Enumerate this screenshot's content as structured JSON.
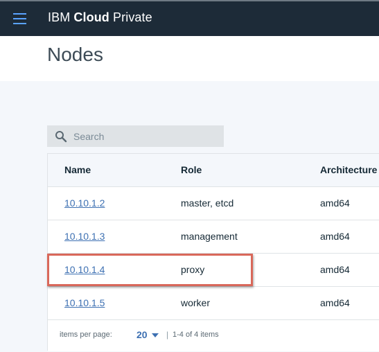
{
  "header": {
    "brand_prefix": "IBM",
    "brand_bold": "Cloud",
    "brand_suffix": "Private"
  },
  "page": {
    "title": "Nodes"
  },
  "search": {
    "placeholder": "Search",
    "value": ""
  },
  "table": {
    "columns": [
      "Name",
      "Role",
      "Architecture"
    ],
    "rows": [
      {
        "name": "10.10.1.2",
        "role": "master, etcd",
        "arch": "amd64"
      },
      {
        "name": "10.10.1.3",
        "role": "management",
        "arch": "amd64"
      },
      {
        "name": "10.10.1.4",
        "role": "proxy",
        "arch": "amd64"
      },
      {
        "name": "10.10.1.5",
        "role": "worker",
        "arch": "amd64"
      }
    ]
  },
  "pagination": {
    "items_per_page_label": "items per page:",
    "items_per_page_value": "20",
    "separator": "|",
    "range_text": "1-4 of 4 items"
  },
  "annotation": {
    "highlight_color": "#d9685a"
  },
  "colors": {
    "topbar": "#1d2b38",
    "link": "#3d70b2",
    "hamburger": "#5aa3ff"
  }
}
